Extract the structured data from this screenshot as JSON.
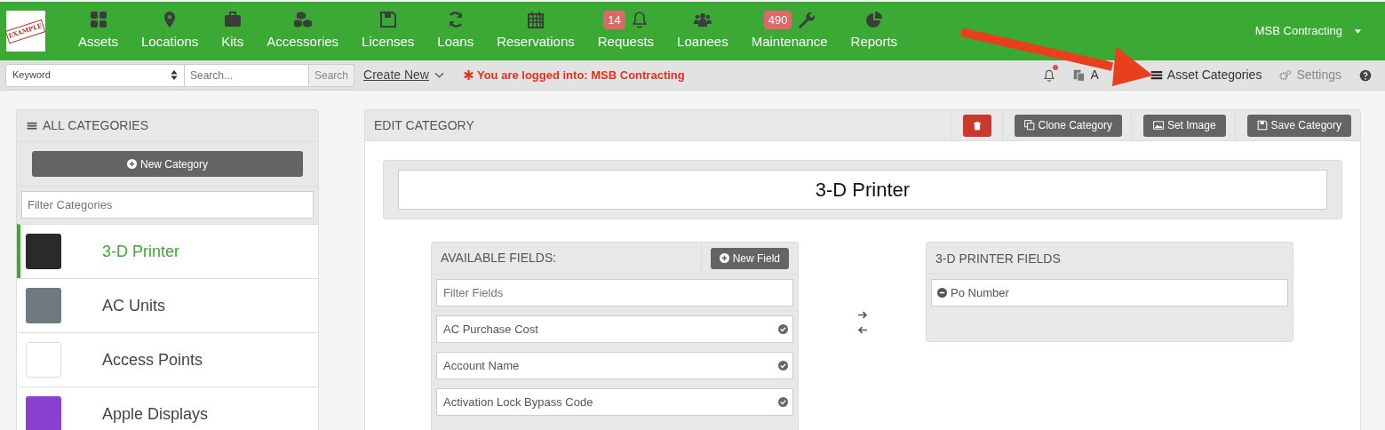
{
  "logo": {
    "text": "EXAMPLE"
  },
  "nav": [
    {
      "label": "Assets"
    },
    {
      "label": "Locations"
    },
    {
      "label": "Kits"
    },
    {
      "label": "Accessories"
    },
    {
      "label": "Licenses"
    },
    {
      "label": "Loans"
    },
    {
      "label": "Reservations"
    },
    {
      "label": "Requests",
      "badge": "14"
    },
    {
      "label": "Loanees"
    },
    {
      "label": "Maintenance",
      "badge": "490"
    },
    {
      "label": "Reports"
    }
  ],
  "account": {
    "label": "MSB Contracting"
  },
  "toolbar": {
    "search_scope": "Keyword",
    "search_placeholder": "Search...",
    "search_button": "Search",
    "create_new": "Create New",
    "login_notice": "You are logged into: MSB Contracting",
    "notifications": {
      "unread": true
    },
    "links": [
      {
        "label": "A"
      },
      {
        "label": "Asset Categories"
      },
      {
        "label": "Settings"
      }
    ]
  },
  "sidebar": {
    "title": "ALL CATEGORIES",
    "new_button": "New Category",
    "filter_placeholder": "Filter Categories",
    "items": [
      {
        "label": "3-D Printer",
        "selected": true
      },
      {
        "label": "AC Units",
        "selected": false
      },
      {
        "label": "Access Points",
        "selected": false
      },
      {
        "label": "Apple Displays",
        "selected": false
      }
    ]
  },
  "editor": {
    "title": "EDIT CATEGORY",
    "buttons": [
      "Clone Category",
      "Set Image",
      "Save Category"
    ],
    "name": "3-D Printer",
    "available": {
      "title": "AVAILABLE FIELDS:",
      "new_button": "New Field",
      "filter_placeholder": "Filter Fields",
      "fields": [
        "AC Purchase Cost",
        "Account Name",
        "Activation Lock Bypass Code"
      ]
    },
    "assigned": {
      "title": "3-D PRINTER FIELDS",
      "fields": [
        "Po Number"
      ]
    }
  }
}
